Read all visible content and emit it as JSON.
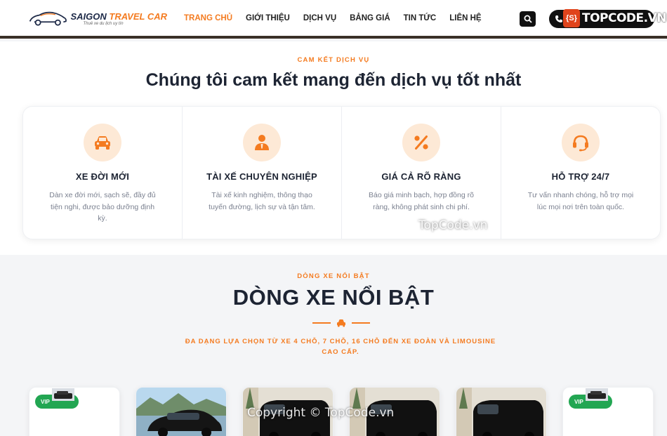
{
  "brand": {
    "name_part1": "SAIGON",
    "name_part2": "TRAVEL CAR",
    "tagline": "Thuê xe du lịch uy tín"
  },
  "nav": {
    "items": [
      "TRANG CHỦ",
      "GIỚI THIỆU",
      "DỊCH VỤ",
      "BẢNG GIÁ",
      "TIN TỨC",
      "LIÊN HỆ"
    ],
    "active_index": 0
  },
  "header": {
    "search_icon": "search-icon",
    "phone_icon": "phone-icon"
  },
  "watermark_badge": {
    "shield_text": "{S}",
    "text": "TOPCODE.VN"
  },
  "commitment": {
    "eyebrow": "CAM KẾT DỊCH VỤ",
    "title": "Chúng tôi cam kết mang đến dịch vụ tốt nhất",
    "cards": [
      {
        "icon": "car-icon",
        "title": "XE ĐỜI MỚI",
        "desc": "Dàn xe đời mới, sạch sẽ, đầy đủ tiện nghi, được bảo dưỡng định kỳ."
      },
      {
        "icon": "driver-icon",
        "title": "TÀI XẾ CHUYÊN NGHIỆP",
        "desc": "Tài xế kinh nghiệm, thông thạo tuyến đường, lịch sự và tận tâm."
      },
      {
        "icon": "percent-icon",
        "title": "GIÁ CẢ RÕ RÀNG",
        "desc": "Báo giá minh bạch, hợp đồng rõ ràng, không phát sinh chi phí."
      },
      {
        "icon": "headset-icon",
        "title": "HỖ TRỢ 24/7",
        "desc": "Tư vấn nhanh chóng, hỗ trợ mọi lúc mọi nơi trên toàn quốc."
      }
    ]
  },
  "car_lines": {
    "eyebrow": "DÒNG XE NỔI BẬT",
    "title": "DÒNG XE NỔI BẬT",
    "subtitle": "ĐA DẠNG LỰA CHỌN TỪ XE 4 CHỖ, 7 CHỖ, 16 CHỖ ĐẾN XE ĐOÀN VÀ LIMOUSINE CAO CẤP.",
    "badge": "VIP",
    "cards": [
      "vip",
      "sedan",
      "van",
      "van",
      "van",
      "vip"
    ]
  },
  "watermarks": {
    "center": "TopCode.vn",
    "bottom": "Copyright © TopCode.vn"
  },
  "colors": {
    "accent": "#f47b20",
    "navy": "#1e2a48",
    "icon_bg": "#fde9d6",
    "vip_green": "#22a652"
  }
}
